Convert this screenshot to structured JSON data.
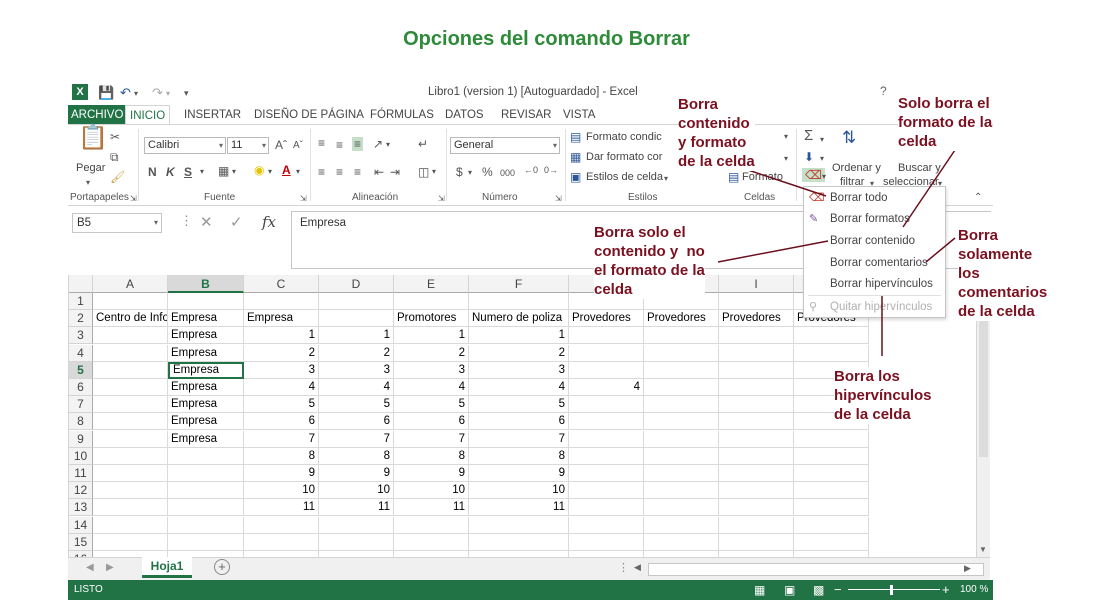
{
  "slide": {
    "title": "Opciones del comando Borrar"
  },
  "window": {
    "title": "Libro1 (version 1) [Autoguardado] - Excel",
    "help": "?"
  },
  "tabs": [
    "ARCHIVO",
    "INICIO",
    "INSERTAR",
    "DISEÑO DE PÁGINA",
    "FÓRMULAS",
    "DATOS",
    "REVISAR",
    "VISTA"
  ],
  "ribbon": {
    "groups": [
      "Portapapeles",
      "Fuente",
      "Alineación",
      "Número",
      "Estilos",
      "Celdas"
    ],
    "paste_label": "Pegar",
    "font_name": "Calibri",
    "font_size": "11",
    "bold": "N",
    "italic": "K",
    "underline": "S",
    "number_format": "General",
    "conditional_format": "Formato condic",
    "format_as_table": "Dar formato cor",
    "cell_styles": "Estilos de celda",
    "format": "Formato",
    "sort_filter_1": "Ordenar y",
    "sort_filter_2": "filtrar",
    "find_select_1": "Buscar y",
    "find_select_2": "seleccionar",
    "currency": "$",
    "percent": "%",
    "thousands": "000"
  },
  "formula_bar": {
    "name_box": "B5",
    "fx": "fx",
    "value": "Empresa"
  },
  "columns": [
    "A",
    "B",
    "C",
    "D",
    "E",
    "F",
    "G",
    "H",
    "I",
    "J"
  ],
  "rows": [
    {
      "n": "1",
      "cells": [
        "",
        "",
        "",
        "",
        "",
        "",
        "",
        "",
        "",
        ""
      ]
    },
    {
      "n": "2",
      "cells": [
        "Centro de Info",
        "Empresa",
        "Empresa",
        "",
        "Promotores",
        "Numero de poliza",
        "Provedores",
        "Provedores",
        "Provedores",
        "Provedores"
      ]
    },
    {
      "n": "3",
      "cells": [
        "",
        "Empresa",
        "1",
        "1",
        "1",
        "1",
        "",
        "",
        "",
        ""
      ]
    },
    {
      "n": "4",
      "cells": [
        "",
        "Empresa",
        "2",
        "2",
        "2",
        "2",
        "",
        "",
        "",
        ""
      ]
    },
    {
      "n": "5",
      "cells": [
        "",
        "Empresa",
        "3",
        "3",
        "3",
        "3",
        "",
        "",
        "",
        ""
      ]
    },
    {
      "n": "6",
      "cells": [
        "",
        "Empresa",
        "4",
        "4",
        "4",
        "4",
        "4",
        "",
        "",
        ""
      ]
    },
    {
      "n": "7",
      "cells": [
        "",
        "Empresa",
        "5",
        "5",
        "5",
        "5",
        "",
        "",
        "",
        ""
      ]
    },
    {
      "n": "8",
      "cells": [
        "",
        "Empresa",
        "6",
        "6",
        "6",
        "6",
        "",
        "",
        "",
        ""
      ]
    },
    {
      "n": "9",
      "cells": [
        "",
        "Empresa",
        "7",
        "7",
        "7",
        "7",
        "",
        "",
        "",
        ""
      ]
    },
    {
      "n": "10",
      "cells": [
        "",
        "",
        "8",
        "8",
        "8",
        "8",
        "",
        "",
        "",
        ""
      ]
    },
    {
      "n": "11",
      "cells": [
        "",
        "",
        "9",
        "9",
        "9",
        "9",
        "",
        "",
        "",
        ""
      ]
    },
    {
      "n": "12",
      "cells": [
        "",
        "",
        "10",
        "10",
        "10",
        "10",
        "",
        "",
        "",
        ""
      ]
    },
    {
      "n": "13",
      "cells": [
        "",
        "",
        "11",
        "11",
        "11",
        "11",
        "",
        "",
        "",
        ""
      ]
    },
    {
      "n": "14",
      "cells": [
        "",
        "",
        "",
        "",
        "",
        "",
        "",
        "",
        "",
        ""
      ]
    },
    {
      "n": "15",
      "cells": [
        "",
        "",
        "",
        "",
        "",
        "",
        "",
        "",
        "",
        ""
      ]
    },
    {
      "n": "16",
      "cells": [
        "",
        "",
        "",
        "",
        "",
        "",
        "",
        "",
        "",
        ""
      ]
    }
  ],
  "sheet": {
    "tab": "Hoja1",
    "add": "+"
  },
  "status": {
    "ready": "LISTO",
    "zoom": "100 %",
    "minus": "−",
    "plus": "+"
  },
  "menu": {
    "items": [
      {
        "label": "Borrar todo",
        "icon": "eraser-icon",
        "enabled": true
      },
      {
        "label": "Borrar formatos",
        "icon": "eraser-format-icon",
        "enabled": true
      },
      {
        "label": "Borrar contenido",
        "icon": "",
        "enabled": true
      },
      {
        "label": "Borrar comentarios",
        "icon": "",
        "enabled": true
      },
      {
        "label": "Borrar hipervínculos",
        "icon": "",
        "enabled": true
      },
      {
        "label": "Quitar hipervínculos",
        "icon": "unlink-icon",
        "enabled": false
      }
    ]
  },
  "annotations": {
    "contenido_formato": "Borra\ncontenido\ny formato\nde la celda",
    "solo_formato": "Solo borra el\nformato de la\ncelda",
    "solo_contenido": "Borra solo el\ncontenido y  no\nel formato de la\ncelda",
    "comentarios": "Borra\nsolamente\nlos\ncomentarios\nde la celda",
    "hipervinculos": "Borra los\nhipervínculos\nde la celda"
  },
  "colors": {
    "excel_green": "#217346",
    "annotation": "#7b1020",
    "title": "#2e8b3a"
  }
}
